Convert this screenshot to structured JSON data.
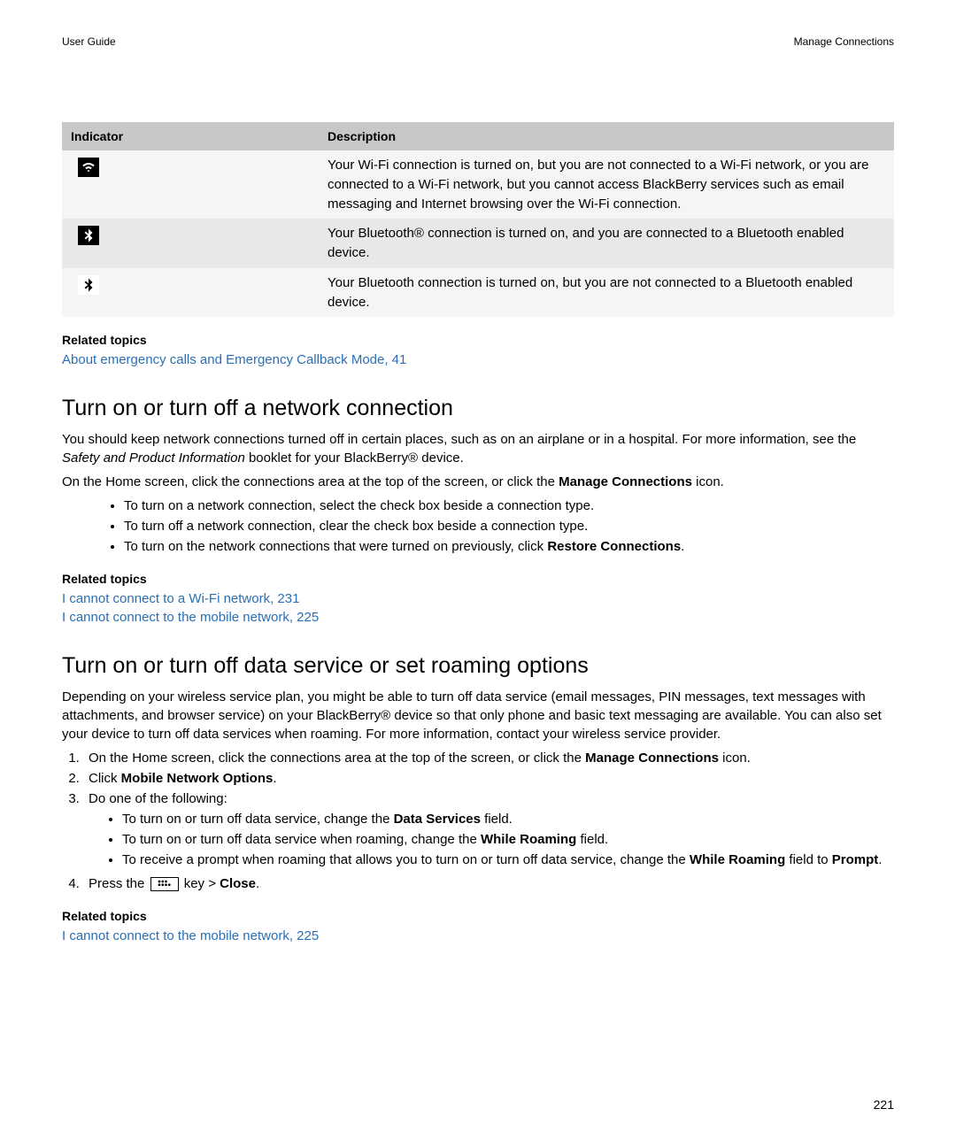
{
  "header": {
    "left": "User Guide",
    "right": "Manage Connections"
  },
  "table": {
    "col1": "Indicator",
    "col2": "Description",
    "rows": [
      {
        "icon": "wifi-limited-icon",
        "desc": "Your Wi-Fi connection is turned on, but you are not connected to a Wi-Fi network, or you are connected to a Wi-Fi network, but you cannot access BlackBerry services such as email messaging and Internet browsing over the Wi-Fi connection."
      },
      {
        "icon": "bluetooth-connected-icon",
        "desc": "Your Bluetooth® connection is turned on, and you are connected to a Bluetooth enabled device."
      },
      {
        "icon": "bluetooth-on-icon",
        "desc": "Your Bluetooth connection is turned on, but you are not connected to a Bluetooth enabled device."
      }
    ]
  },
  "relatedTopicsLabel": "Related topics",
  "related1": {
    "link1": "About emergency calls and Emergency Callback Mode, 41"
  },
  "section1": {
    "title": "Turn on or turn off a network connection",
    "p1a": "You should keep network connections turned off in certain places, such as on an airplane or in a hospital. For more information, see the ",
    "p1b_italic": "Safety and Product Information",
    "p1c": " booklet for your BlackBerry® device.",
    "p2a": "On the Home screen, click the connections area at the top of the screen, or click the ",
    "p2b_bold": "Manage Connections",
    "p2c": " icon.",
    "bullets": {
      "b1": "To turn on a network connection, select the check box beside a connection type.",
      "b2": "To turn off a network connection, clear the check box beside a connection type.",
      "b3a": "To turn on the network connections that were turned on previously, click ",
      "b3b_bold": "Restore Connections",
      "b3c": "."
    }
  },
  "related2": {
    "link1": "I cannot connect to a Wi-Fi network, 231",
    "link2": "I cannot connect to the mobile network, 225"
  },
  "section2": {
    "title": "Turn on or turn off data service or set roaming options",
    "p1": "Depending on your wireless service plan, you might be able to turn off data service (email messages, PIN messages, text messages with attachments, and browser service) on your BlackBerry® device so that only phone and basic text messaging are available. You can also set your device to turn off data services when roaming. For more information, contact your wireless service provider.",
    "steps": {
      "s1a": "On the Home screen, click the connections area at the top of the screen, or click the ",
      "s1b_bold": "Manage Connections",
      "s1c": " icon.",
      "s2a": "Click ",
      "s2b_bold": "Mobile Network Options",
      "s2c": ".",
      "s3": "Do one of the following:",
      "s3_bullets": {
        "b1a": "To turn on or turn off data service, change the ",
        "b1b_bold": "Data Services",
        "b1c": " field.",
        "b2a": "To turn on or turn off data service when roaming, change the ",
        "b2b_bold": "While Roaming",
        "b2c": " field.",
        "b3a": "To receive a prompt when roaming that allows you to turn on or turn off data service, change the ",
        "b3b_bold": "While Roaming",
        "b3c": " field to ",
        "b3d_bold": "Prompt",
        "b3e": "."
      },
      "s4a": "Press the ",
      "s4b": " key > ",
      "s4c_bold": "Close",
      "s4d": "."
    }
  },
  "related3": {
    "link1": "I cannot connect to the mobile network, 225"
  },
  "pageNumber": "221"
}
